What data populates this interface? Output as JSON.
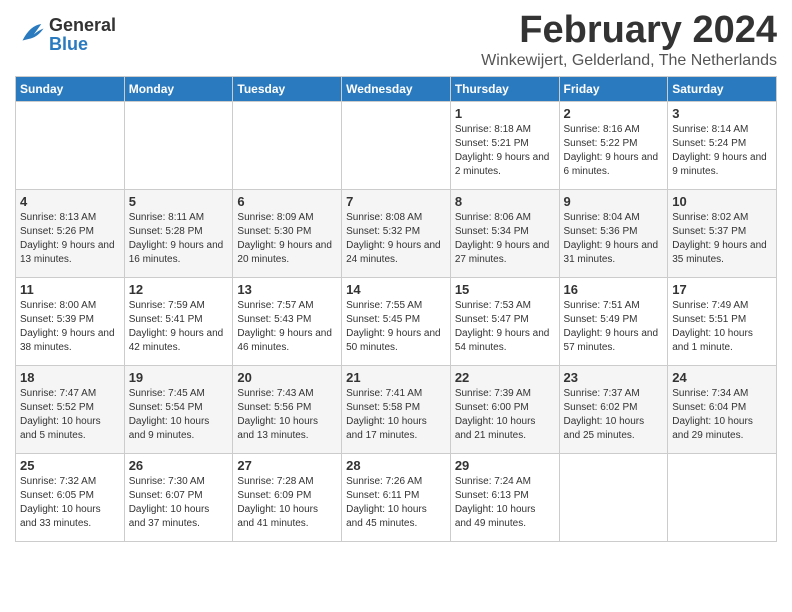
{
  "logo": {
    "general": "General",
    "blue": "Blue"
  },
  "title": "February 2024",
  "location": "Winkewijert, Gelderland, The Netherlands",
  "weekdays": [
    "Sunday",
    "Monday",
    "Tuesday",
    "Wednesday",
    "Thursday",
    "Friday",
    "Saturday"
  ],
  "weeks": [
    [
      {
        "day": "",
        "sunrise": "",
        "sunset": "",
        "daylight": ""
      },
      {
        "day": "",
        "sunrise": "",
        "sunset": "",
        "daylight": ""
      },
      {
        "day": "",
        "sunrise": "",
        "sunset": "",
        "daylight": ""
      },
      {
        "day": "",
        "sunrise": "",
        "sunset": "",
        "daylight": ""
      },
      {
        "day": "1",
        "sunrise": "Sunrise: 8:18 AM",
        "sunset": "Sunset: 5:21 PM",
        "daylight": "Daylight: 9 hours and 2 minutes."
      },
      {
        "day": "2",
        "sunrise": "Sunrise: 8:16 AM",
        "sunset": "Sunset: 5:22 PM",
        "daylight": "Daylight: 9 hours and 6 minutes."
      },
      {
        "day": "3",
        "sunrise": "Sunrise: 8:14 AM",
        "sunset": "Sunset: 5:24 PM",
        "daylight": "Daylight: 9 hours and 9 minutes."
      }
    ],
    [
      {
        "day": "4",
        "sunrise": "Sunrise: 8:13 AM",
        "sunset": "Sunset: 5:26 PM",
        "daylight": "Daylight: 9 hours and 13 minutes."
      },
      {
        "day": "5",
        "sunrise": "Sunrise: 8:11 AM",
        "sunset": "Sunset: 5:28 PM",
        "daylight": "Daylight: 9 hours and 16 minutes."
      },
      {
        "day": "6",
        "sunrise": "Sunrise: 8:09 AM",
        "sunset": "Sunset: 5:30 PM",
        "daylight": "Daylight: 9 hours and 20 minutes."
      },
      {
        "day": "7",
        "sunrise": "Sunrise: 8:08 AM",
        "sunset": "Sunset: 5:32 PM",
        "daylight": "Daylight: 9 hours and 24 minutes."
      },
      {
        "day": "8",
        "sunrise": "Sunrise: 8:06 AM",
        "sunset": "Sunset: 5:34 PM",
        "daylight": "Daylight: 9 hours and 27 minutes."
      },
      {
        "day": "9",
        "sunrise": "Sunrise: 8:04 AM",
        "sunset": "Sunset: 5:36 PM",
        "daylight": "Daylight: 9 hours and 31 minutes."
      },
      {
        "day": "10",
        "sunrise": "Sunrise: 8:02 AM",
        "sunset": "Sunset: 5:37 PM",
        "daylight": "Daylight: 9 hours and 35 minutes."
      }
    ],
    [
      {
        "day": "11",
        "sunrise": "Sunrise: 8:00 AM",
        "sunset": "Sunset: 5:39 PM",
        "daylight": "Daylight: 9 hours and 38 minutes."
      },
      {
        "day": "12",
        "sunrise": "Sunrise: 7:59 AM",
        "sunset": "Sunset: 5:41 PM",
        "daylight": "Daylight: 9 hours and 42 minutes."
      },
      {
        "day": "13",
        "sunrise": "Sunrise: 7:57 AM",
        "sunset": "Sunset: 5:43 PM",
        "daylight": "Daylight: 9 hours and 46 minutes."
      },
      {
        "day": "14",
        "sunrise": "Sunrise: 7:55 AM",
        "sunset": "Sunset: 5:45 PM",
        "daylight": "Daylight: 9 hours and 50 minutes."
      },
      {
        "day": "15",
        "sunrise": "Sunrise: 7:53 AM",
        "sunset": "Sunset: 5:47 PM",
        "daylight": "Daylight: 9 hours and 54 minutes."
      },
      {
        "day": "16",
        "sunrise": "Sunrise: 7:51 AM",
        "sunset": "Sunset: 5:49 PM",
        "daylight": "Daylight: 9 hours and 57 minutes."
      },
      {
        "day": "17",
        "sunrise": "Sunrise: 7:49 AM",
        "sunset": "Sunset: 5:51 PM",
        "daylight": "Daylight: 10 hours and 1 minute."
      }
    ],
    [
      {
        "day": "18",
        "sunrise": "Sunrise: 7:47 AM",
        "sunset": "Sunset: 5:52 PM",
        "daylight": "Daylight: 10 hours and 5 minutes."
      },
      {
        "day": "19",
        "sunrise": "Sunrise: 7:45 AM",
        "sunset": "Sunset: 5:54 PM",
        "daylight": "Daylight: 10 hours and 9 minutes."
      },
      {
        "day": "20",
        "sunrise": "Sunrise: 7:43 AM",
        "sunset": "Sunset: 5:56 PM",
        "daylight": "Daylight: 10 hours and 13 minutes."
      },
      {
        "day": "21",
        "sunrise": "Sunrise: 7:41 AM",
        "sunset": "Sunset: 5:58 PM",
        "daylight": "Daylight: 10 hours and 17 minutes."
      },
      {
        "day": "22",
        "sunrise": "Sunrise: 7:39 AM",
        "sunset": "Sunset: 6:00 PM",
        "daylight": "Daylight: 10 hours and 21 minutes."
      },
      {
        "day": "23",
        "sunrise": "Sunrise: 7:37 AM",
        "sunset": "Sunset: 6:02 PM",
        "daylight": "Daylight: 10 hours and 25 minutes."
      },
      {
        "day": "24",
        "sunrise": "Sunrise: 7:34 AM",
        "sunset": "Sunset: 6:04 PM",
        "daylight": "Daylight: 10 hours and 29 minutes."
      }
    ],
    [
      {
        "day": "25",
        "sunrise": "Sunrise: 7:32 AM",
        "sunset": "Sunset: 6:05 PM",
        "daylight": "Daylight: 10 hours and 33 minutes."
      },
      {
        "day": "26",
        "sunrise": "Sunrise: 7:30 AM",
        "sunset": "Sunset: 6:07 PM",
        "daylight": "Daylight: 10 hours and 37 minutes."
      },
      {
        "day": "27",
        "sunrise": "Sunrise: 7:28 AM",
        "sunset": "Sunset: 6:09 PM",
        "daylight": "Daylight: 10 hours and 41 minutes."
      },
      {
        "day": "28",
        "sunrise": "Sunrise: 7:26 AM",
        "sunset": "Sunset: 6:11 PM",
        "daylight": "Daylight: 10 hours and 45 minutes."
      },
      {
        "day": "29",
        "sunrise": "Sunrise: 7:24 AM",
        "sunset": "Sunset: 6:13 PM",
        "daylight": "Daylight: 10 hours and 49 minutes."
      },
      {
        "day": "",
        "sunrise": "",
        "sunset": "",
        "daylight": ""
      },
      {
        "day": "",
        "sunrise": "",
        "sunset": "",
        "daylight": ""
      }
    ]
  ]
}
